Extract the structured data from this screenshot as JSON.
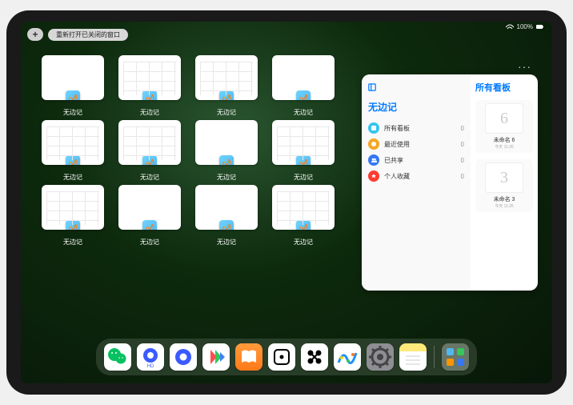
{
  "status_bar": {
    "battery_text": "100%"
  },
  "top_controls": {
    "plus": "+",
    "reopen_label": "重新打开已关闭的窗口"
  },
  "windows": [
    {
      "label": "无边记",
      "variant": "blank"
    },
    {
      "label": "无边记",
      "variant": "grid"
    },
    {
      "label": "无边记",
      "variant": "grid"
    },
    {
      "label": "无边记",
      "variant": "blank"
    },
    {
      "label": "无边记",
      "variant": "grid"
    },
    {
      "label": "无边记",
      "variant": "grid"
    },
    {
      "label": "无边记",
      "variant": "blank"
    },
    {
      "label": "无边记",
      "variant": "grid"
    },
    {
      "label": "无边记",
      "variant": "grid"
    },
    {
      "label": "无边记",
      "variant": "blank"
    },
    {
      "label": "无边记",
      "variant": "blank"
    },
    {
      "label": "无边记",
      "variant": "grid"
    }
  ],
  "side_panel": {
    "left_title": "无边记",
    "right_title": "所有看板",
    "items": [
      {
        "icon_color": "#34c5f0",
        "label": "所有看板",
        "count": "0"
      },
      {
        "icon_color": "#f5a623",
        "label": "最近使用",
        "count": "0"
      },
      {
        "icon_color": "#3478f6",
        "label": "已共享",
        "count": "0"
      },
      {
        "icon_color": "#ff3b30",
        "label": "个人收藏",
        "count": "0"
      }
    ],
    "boards": [
      {
        "glyph": "6",
        "name": "未命名 6",
        "date": "今天 11:26"
      },
      {
        "glyph": "3",
        "name": "未命名 3",
        "date": "今天 11:25"
      }
    ]
  },
  "ellipsis": "···",
  "dock": [
    {
      "name": "wechat",
      "bg": "#ffffff"
    },
    {
      "name": "quark-hd",
      "bg": "#ffffff"
    },
    {
      "name": "quark",
      "bg": "#ffffff"
    },
    {
      "name": "play-video",
      "bg": "#ffffff"
    },
    {
      "name": "books",
      "bg": "linear-gradient(#ff9a3c,#ff7a1a)"
    },
    {
      "name": "dice",
      "bg": "#ffffff"
    },
    {
      "name": "connect",
      "bg": "#ffffff"
    },
    {
      "name": "freeform",
      "bg": "#ffffff"
    },
    {
      "name": "settings",
      "bg": "#8e8e93"
    },
    {
      "name": "notes",
      "bg": "linear-gradient(#ffe97a 0 30%, #ffffff 30%)"
    },
    {
      "name": "app-library",
      "bg": "rgba(255,255,255,0.3)"
    }
  ]
}
